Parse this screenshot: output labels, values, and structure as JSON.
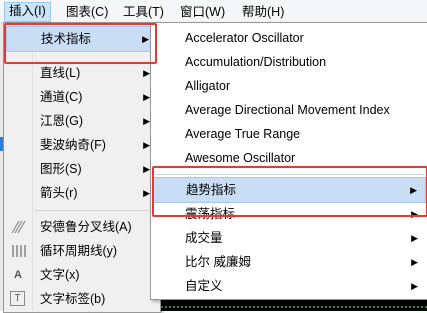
{
  "menubar": {
    "items": [
      "插入(I)",
      "图表(C)",
      "工具(T)",
      "窗口(W)",
      "帮助(H)"
    ]
  },
  "insert_menu": {
    "items": [
      {
        "label": "技术指标",
        "submenu": true,
        "highlighted": true
      },
      {
        "label": "直线(L)",
        "submenu": true
      },
      {
        "label": "通道(C)",
        "submenu": true
      },
      {
        "label": "江恩(G)",
        "submenu": true
      },
      {
        "label": "斐波纳奇(F)",
        "submenu": true
      },
      {
        "label": "图形(S)",
        "submenu": true
      },
      {
        "label": "箭头(r)",
        "submenu": true
      },
      {
        "label": "安德鲁分叉线(A)",
        "icon": "andrews-pitchfork-icon"
      },
      {
        "label": "循环周期线(y)",
        "icon": "cycle-lines-icon"
      },
      {
        "label": "文字(x)",
        "icon": "text-icon",
        "glyph": "A"
      },
      {
        "label": "文字标签(b)",
        "icon": "text-label-icon",
        "glyph": "T"
      }
    ]
  },
  "indicators_menu": {
    "items": [
      {
        "label": "Accelerator Oscillator"
      },
      {
        "label": "Accumulation/Distribution"
      },
      {
        "label": "Alligator"
      },
      {
        "label": "Average Directional Movement Index"
      },
      {
        "label": "Average True Range"
      },
      {
        "label": "Awesome Oscillator"
      },
      {
        "label": "趋势指标",
        "submenu": true,
        "highlighted": true
      },
      {
        "label": "震荡指标",
        "submenu": true
      },
      {
        "label": "成交量",
        "submenu": true
      },
      {
        "label": "比尔 威廉姆",
        "submenu": true
      },
      {
        "label": "自定义",
        "submenu": true
      }
    ]
  },
  "colors": {
    "highlight": "#c9def5",
    "annotation": "#e53935"
  }
}
